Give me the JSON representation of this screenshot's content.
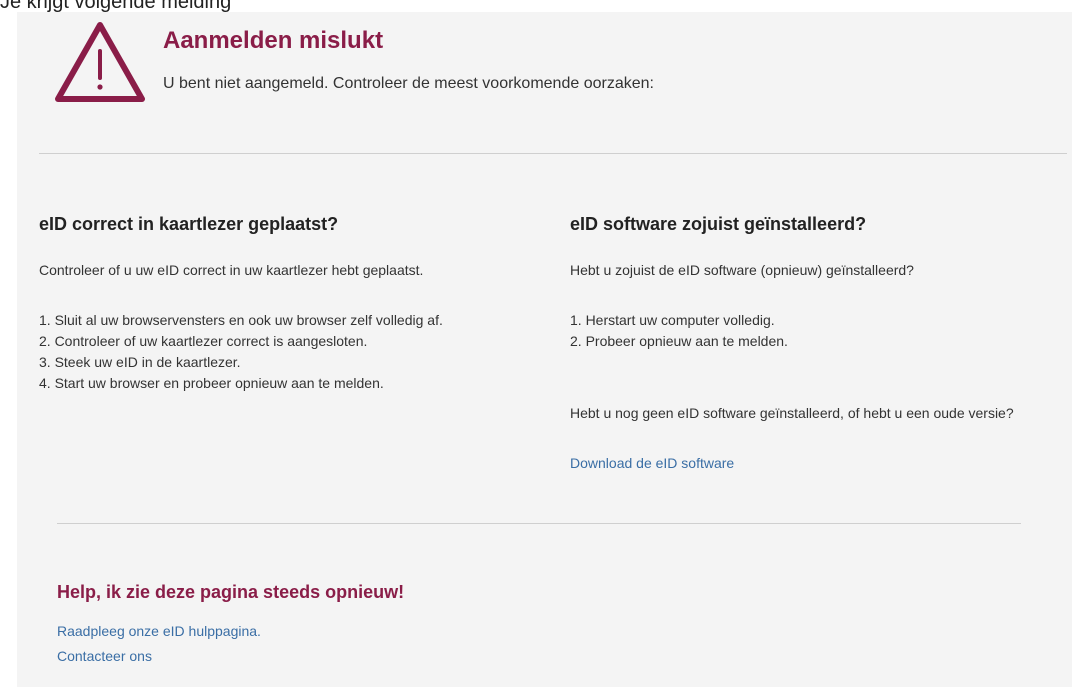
{
  "caption": "Je krijgt volgende melding",
  "header": {
    "title": "Aanmelden mislukt",
    "subtitle": "U bent niet aangemeld. Controleer de meest voorkomende oorzaken:"
  },
  "left": {
    "heading": "eID correct in kaartlezer geplaatst?",
    "intro": "Controleer of u uw eID correct in uw kaartlezer hebt geplaatst.",
    "steps": [
      "1. Sluit al uw browservensters en ook uw browser zelf volledig af.",
      "2. Controleer of uw kaartlezer correct is aangesloten.",
      "3. Steek uw eID in de kaartlezer.",
      "4. Start uw browser en probeer opnieuw aan te melden."
    ]
  },
  "right": {
    "heading": "eID software zojuist geïnstalleerd?",
    "intro": "Hebt u zojuist de eID software (opnieuw) geïnstalleerd?",
    "steps": [
      "1. Herstart uw computer volledig.",
      "2. Probeer opnieuw aan te melden."
    ],
    "note": "Hebt u nog geen eID software geïnstalleerd, of hebt u een oude versie?",
    "download_link": "Download de eID software"
  },
  "help": {
    "title": "Help, ik zie deze pagina steeds opnieuw!",
    "links": [
      "Raadpleeg onze eID hulppagina.",
      "Contacteer ons"
    ]
  },
  "colors": {
    "accent": "#8a1d48",
    "link": "#3a6ea5",
    "panel_bg": "#f4f4f4"
  },
  "icons": {
    "warning": "warning-triangle-icon"
  }
}
